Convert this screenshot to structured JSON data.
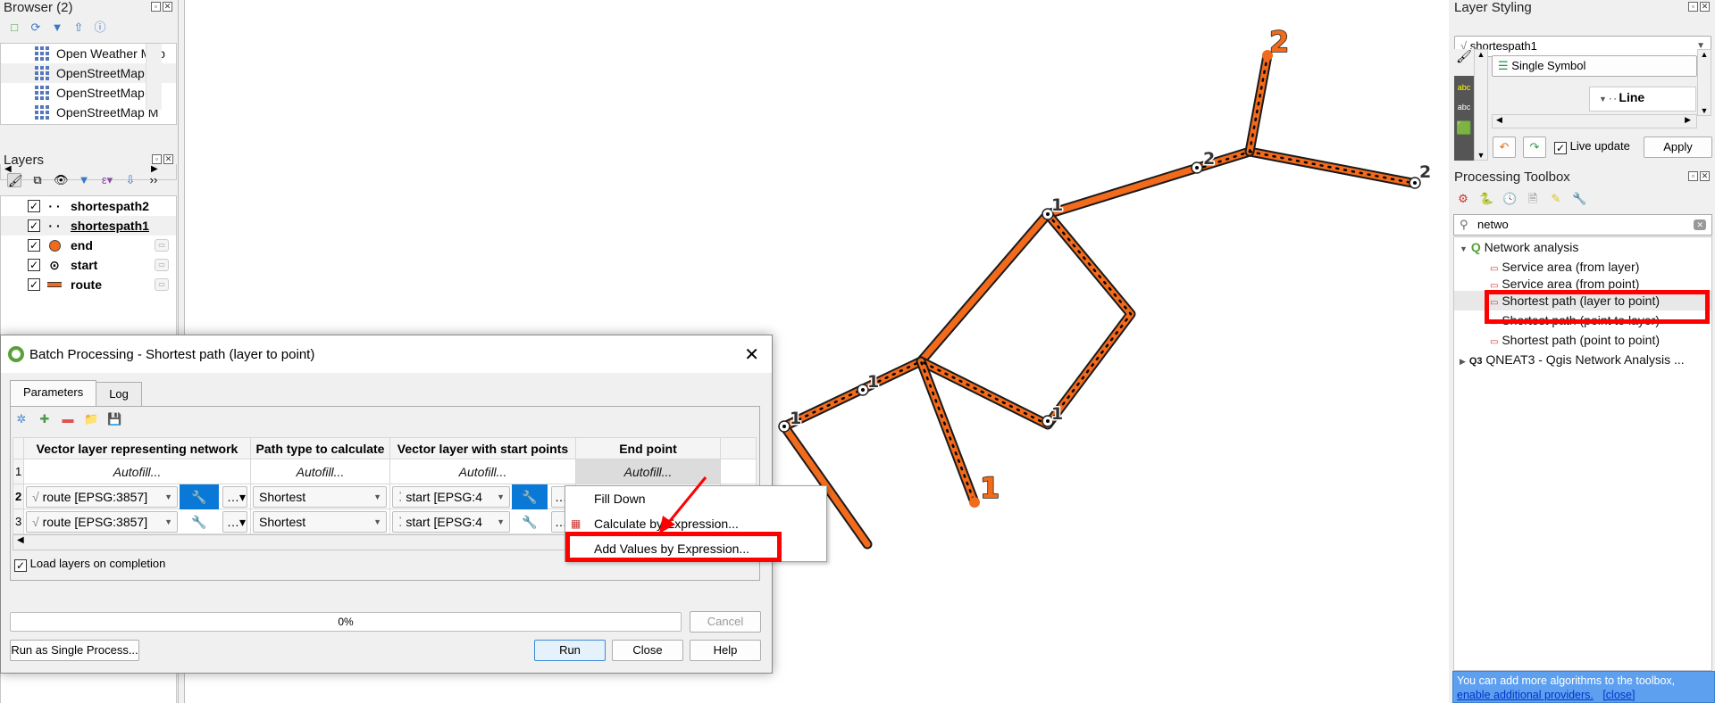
{
  "browser": {
    "title": "Browser (2)",
    "items": [
      "Open Weather Map",
      "OpenStreetMap",
      "OpenStreetMap H",
      "OpenStreetMap M"
    ]
  },
  "layers": {
    "title": "Layers",
    "items": [
      {
        "name": "shortespath2",
        "checked": true,
        "symbol": "dotted-line"
      },
      {
        "name": "shortespath1",
        "checked": true,
        "symbol": "dotted-line",
        "active": true
      },
      {
        "name": "end",
        "checked": true,
        "symbol": "orange-circle"
      },
      {
        "name": "start",
        "checked": true,
        "symbol": "point-ring"
      },
      {
        "name": "route",
        "checked": true,
        "symbol": "orange-line"
      }
    ]
  },
  "map": {
    "labels": [
      "2",
      "2",
      "2",
      "1",
      "1",
      "1",
      "1",
      "1"
    ],
    "colors": {
      "route": "#f26a1b",
      "outline": "#1a1a1a"
    }
  },
  "dialog": {
    "title": "Batch Processing - Shortest path (layer to point)",
    "tabs": [
      "Parameters",
      "Log"
    ],
    "columns": [
      "Vector layer representing network",
      "Path type to calculate",
      "Vector layer with start points",
      "End point"
    ],
    "autofill": "Autofill...",
    "rows": [
      {
        "n": "2",
        "network": "route [EPSG:3857]",
        "path_type": "Shortest",
        "start": "start [EPSG:4"
      },
      {
        "n": "3",
        "network": "route [EPSG:3857]",
        "path_type": "Shortest",
        "start": "start [EPSG:4"
      }
    ],
    "row1_label": "1",
    "load_layers": "Load layers on completion",
    "progress": "0%",
    "buttons": {
      "cancel": "Cancel",
      "single": "Run as Single Process...",
      "run": "Run",
      "close": "Close",
      "help": "Help"
    },
    "context_menu": [
      "Fill Down",
      "Calculate by Expression...",
      "Add Values by Expression..."
    ]
  },
  "styling": {
    "title": "Layer Styling",
    "layer": "shortespath1",
    "renderer": "Single Symbol",
    "symbol": "Line",
    "live_update": "Live update",
    "apply": "Apply"
  },
  "toolbox": {
    "title": "Processing Toolbox",
    "search": "netwo",
    "group": "Network analysis",
    "items": [
      "Service area (from layer)",
      "Service area (from point)",
      "Shortest path (layer to point)",
      "Shortest path (point to layer)",
      "Shortest path (point to point)"
    ],
    "group2": "QNEAT3 - Qgis Network Analysis ...",
    "notice_text": "You can add more algorithms to the toolbox,",
    "notice_link": "enable additional providers.",
    "notice_close": "[close]"
  },
  "highlight_color": "#ff0000"
}
